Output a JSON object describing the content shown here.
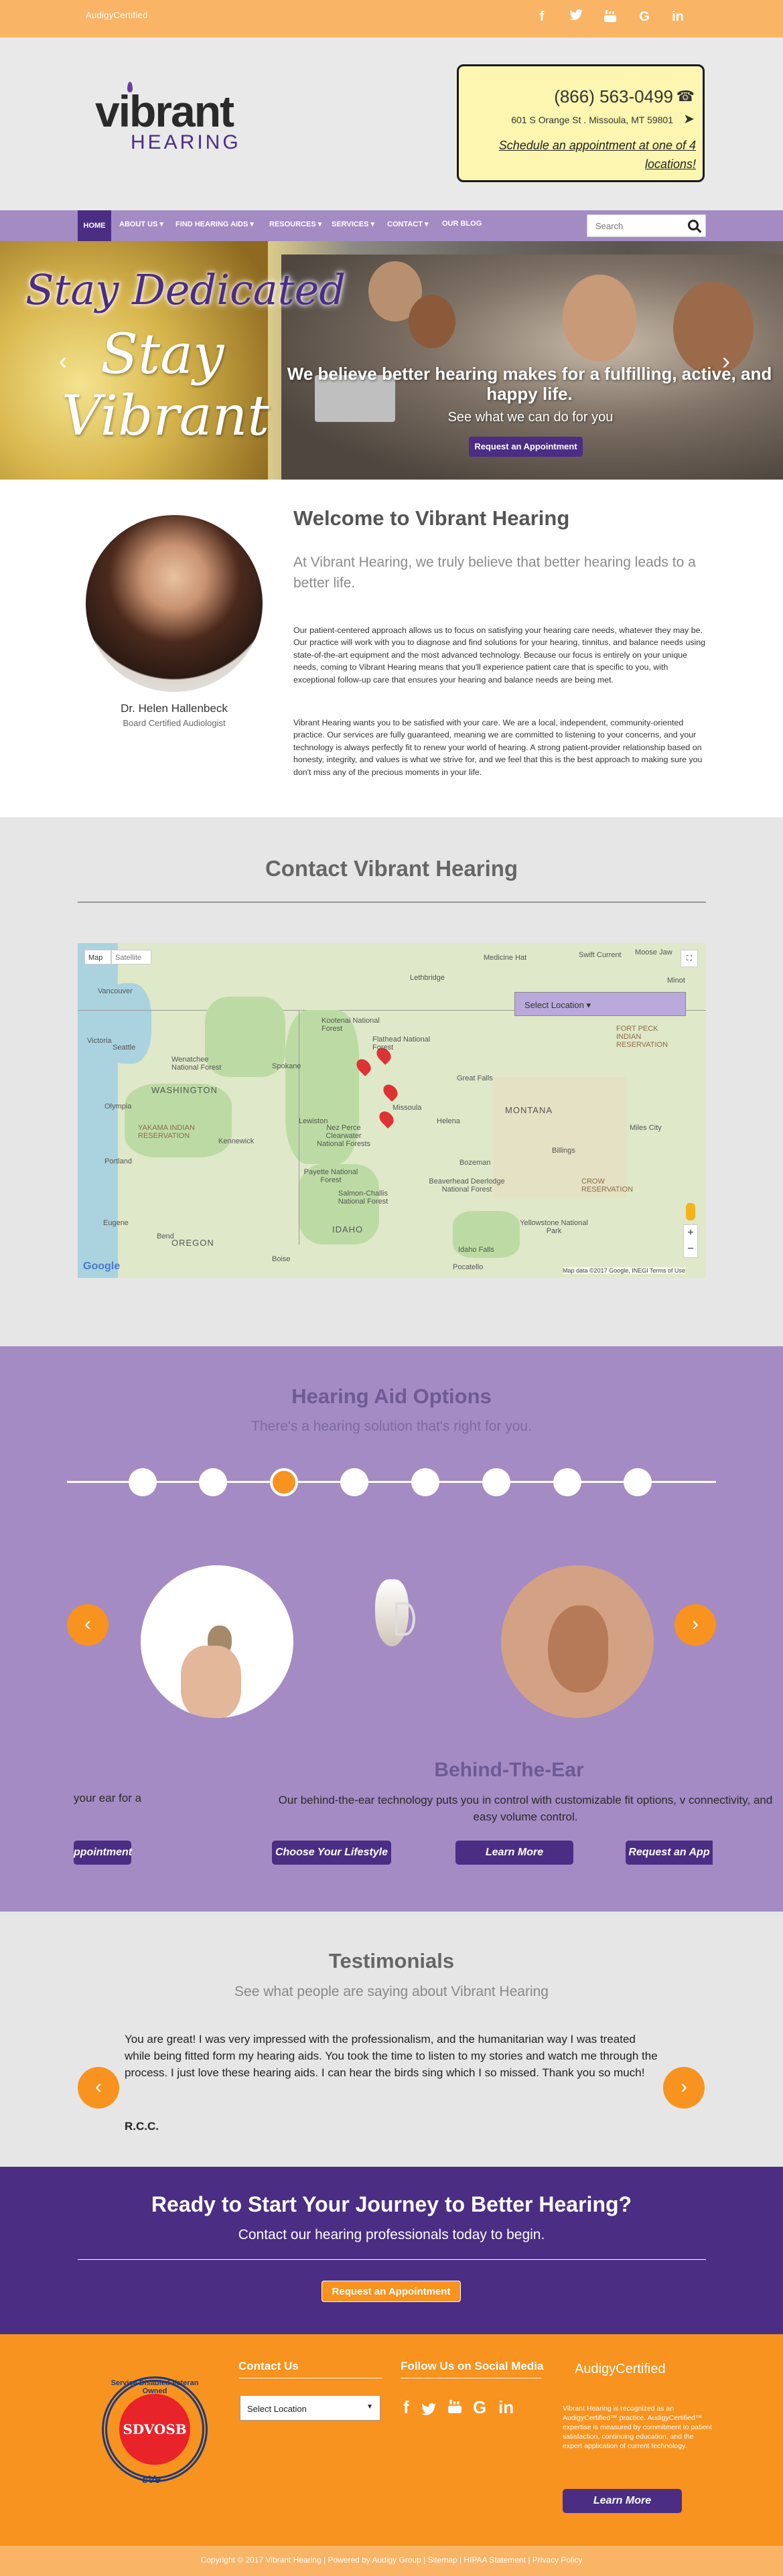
{
  "topbar": {
    "brand": "AudigyCertified",
    "brand_tag": "",
    "social": [
      "f",
      "t",
      "yt",
      "G",
      "in"
    ]
  },
  "header": {
    "logo_main": "vibrant",
    "logo_sub": "HEARING",
    "phone": "(866) 563-0499",
    "address": "601 S Orange St . Missoula, MT 59801",
    "schedule": "Schedule an appointment at one of 4 locations!"
  },
  "nav": {
    "items": [
      "HOME",
      "ABOUT US ▾",
      "FIND HEARING AIDS ▾",
      "RESOURCES ▾",
      "SERVICES ▾",
      "CONTACT ▾",
      "OUR BLOG"
    ],
    "search_placeholder": "Search"
  },
  "hero": {
    "tagline": "Stay Dedicated",
    "stay": "Stay",
    "vibrant": "Vibrant",
    "headline": "We believe better hearing makes for a fulfilling, active, and happy life.",
    "sub": "See what we can do for you",
    "button": "Request an Appointment"
  },
  "welcome": {
    "doctor_name": "Dr. Helen Hallenbeck",
    "doctor_title": "Board Certified Audiologist",
    "heading": "Welcome to Vibrant Hearing",
    "lead": "At Vibrant Hearing, we truly believe that better hearing leads to a better life.",
    "p1": "Our patient-centered approach allows us to focus on satisfying your hearing care needs, whatever they may be. Our practice will work with you to diagnose and find solutions for your hearing, tinnitus, and balance needs using state-of-the-art equipment and the most advanced technology. Because our focus is entirely on your unique needs, coming to Vibrant Hearing means that you'll experience patient care that is specific to you, with exceptional follow-up care that ensures your hearing and balance needs are being met.",
    "p2": "Vibrant Hearing wants you to be satisfied with your care. We are a local, independent, community-oriented practice. Our services are fully guaranteed, meaning we are committed to listening to your concerns, and your technology is always perfectly fit to renew your world of hearing. A strong patient-provider relationship based on honesty, integrity, and values is what we strive for, and we feel that this is the best approach to making sure you don't miss any of the precious moments in your life."
  },
  "contact": {
    "heading": "Contact Vibrant Hearing",
    "map_tab_map": "Map",
    "map_tab_sat": "Satellite",
    "select_location": "Select Location ▾",
    "attribution": "Map data ©2017 Google, INEGI   Terms of Use",
    "google": "Google",
    "labels": [
      "Vancouver",
      "Victoria",
      "Seattle",
      "WASHINGTON",
      "Spokane",
      "Olympia",
      "Portland",
      "OREGON",
      "Eugene",
      "Bend",
      "Medicine Hat",
      "Lethbridge",
      "Great Falls",
      "MONTANA",
      "Missoula",
      "Billings",
      "Helena",
      "Bozeman",
      "IDAHO",
      "Idaho Falls",
      "Boise",
      "Nez Perce Clearwater National Forests",
      "Flathead National Forest",
      "Yellowstone National Park",
      "Salmon-Challis National Forest",
      "Beaverhead Deerlodge National Forest",
      "Payette National Forest",
      "Kootenai National Forest",
      "Swift Current",
      "Moose Jaw",
      "Minot",
      "FORT PECK INDIAN RESERVATION",
      "CROW RESERVATION",
      "Miles City",
      "Kennewick",
      "Wenatchee National Forest",
      "YAKAMA INDIAN RESERVATION",
      "Pocatello",
      "Lewiston"
    ]
  },
  "options": {
    "heading": "Hearing Aid Options",
    "sub": "There's a hearing solution that's right for you.",
    "dot_count": 9,
    "active_dot": 2,
    "title": "Behind-The-Ear",
    "desc": "Our behind-the-ear technology puts you in control with customizable fit options, v connectivity, and easy volume control.",
    "left_text": "your ear for a",
    "btn_left": "ppointment",
    "btn_lifestyle": "Choose Your Lifestyle",
    "btn_learn": "Learn More",
    "btn_request": "Request an App"
  },
  "testimonials": {
    "heading": "Testimonials",
    "sub": "See what people are saying about Vibrant Hearing",
    "text": "You are great! I was very impressed with the professionalism, and the humanitarian way I was treated while being fitted form my hearing aids. You took the time to listen to my stories and watch me through the process. I just love these hearing aids. I can hear the birds sing which I so missed. Thank you so much!",
    "name": "R.C.C."
  },
  "cta": {
    "heading": "Ready to Start Your Journey to Better Hearing?",
    "sub": "Contact our hearing professionals today to begin.",
    "button": "Request an Appointment"
  },
  "footer": {
    "contact_heading": "Contact Us",
    "select": "Select Location",
    "social_heading": "Follow Us on Social Media",
    "social": [
      "f",
      "t",
      "yt",
      "G",
      "in"
    ],
    "audigy": "AudigyCertified",
    "audigy_tag": "",
    "desc": "Vibrant Hearing is recognized as an AudigyCertified™ practice. AudigyCertified™ expertise is measured by commitment to patient satisfaction, continuing education, and the expert application of current technology.",
    "learn_more": "Learn More",
    "seal_text": "Service Disabled Veteran Owned",
    "seal_inner": "SDVOSB",
    "seal_bottom": "cVe"
  },
  "bottom": {
    "copyright": "Copyright © 2017 Vibrant Hearing    |    Powered by Audigy Group    |    Sitemap    |    HIPAA Statement    |    Privacy Policy"
  },
  "colors": {
    "purple": "#4b2d84",
    "lavender": "#a48bc4",
    "orange": "#f7931e",
    "peach": "#f9b466"
  }
}
